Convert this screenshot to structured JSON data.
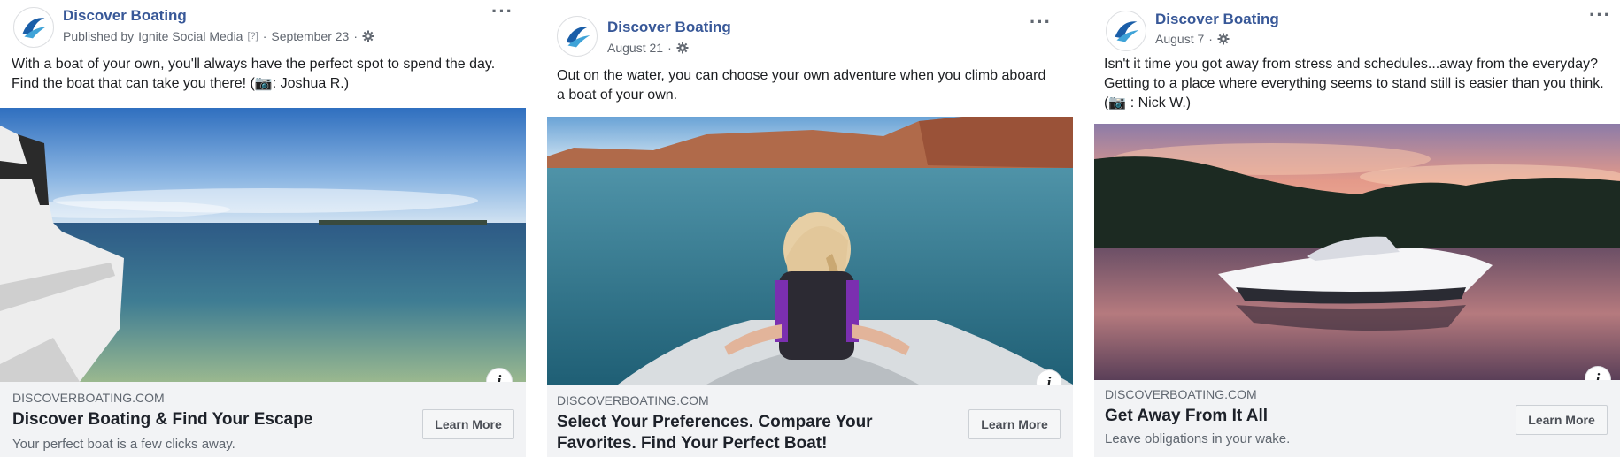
{
  "colors": {
    "brand_link": "#385898",
    "meta_gray": "#616770",
    "link_bg": "#f2f3f5"
  },
  "posts": [
    {
      "page_name": "Discover Boating",
      "published_by_prefix": "Published by",
      "published_by": "Ignite Social Media",
      "help_marker": "[?]",
      "separator": "·",
      "date": "September 23",
      "caption": "With a boat of your own, you'll always have the perfect spot to spend the day. Find the boat that can take you there! (📷: Joshua R.)",
      "domain": "DISCOVERBOATING.COM",
      "headline": "Discover Boating & Find Your Escape",
      "description": "Your perfect boat is a few clicks away.",
      "cta": "Learn More",
      "more_icon": "more-options-icon",
      "privacy_icon": "gear-icon",
      "info_icon": "info-icon",
      "info_glyph": "i",
      "more_glyph": "···"
    },
    {
      "page_name": "Discover Boating",
      "separator": "·",
      "date": "August 21",
      "caption": "Out on the water, you can choose your own adventure when you climb aboard a boat of your own.",
      "domain": "DISCOVERBOATING.COM",
      "headline": "Select Your Preferences. Compare Your Favorites. Find Your Perfect Boat!",
      "cta": "Learn More",
      "info_glyph": "i",
      "more_glyph": "···"
    },
    {
      "page_name": "Discover Boating",
      "separator": "·",
      "date": "August 7",
      "caption": "Isn't it time you got away from stress and schedules...away from the everyday? Getting to a place where everything seems to stand still is easier than you think. (📷 : Nick W.)",
      "domain": "DISCOVERBOATING.COM",
      "headline": "Get Away From It All",
      "description": "Leave obligations in your wake.",
      "cta": "Learn More",
      "info_glyph": "i",
      "more_glyph": "···"
    }
  ]
}
